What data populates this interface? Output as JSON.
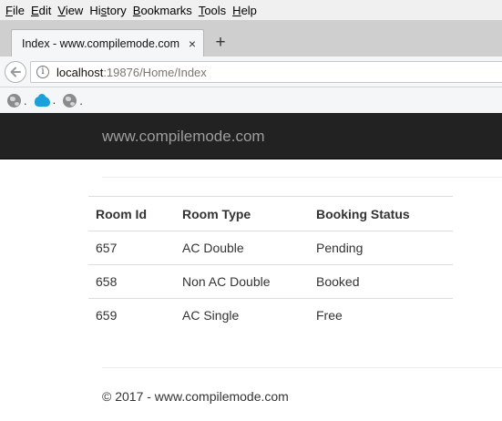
{
  "menu": [
    {
      "accel": "F",
      "rest": "ile"
    },
    {
      "accel": "E",
      "rest": "dit"
    },
    {
      "accel": "V",
      "rest": "iew"
    },
    {
      "pre": "Hi",
      "accel": "s",
      "rest": "tory"
    },
    {
      "accel": "B",
      "rest": "ookmarks"
    },
    {
      "accel": "T",
      "rest": "ools"
    },
    {
      "accel": "H",
      "rest": "elp"
    }
  ],
  "tab": {
    "title": "Index - www.compilemode.com",
    "close": "×",
    "new_tab": "+"
  },
  "address": {
    "host": "localhost",
    "rest": ":19876/Home/Index",
    "info": "i"
  },
  "bookmarks": [
    {
      "icon": "globe-icon",
      "label": "."
    },
    {
      "icon": "salesforce-cloud-icon",
      "label": "."
    },
    {
      "icon": "globe-icon",
      "label": "."
    }
  ],
  "site": {
    "brand": "www.compilemode.com"
  },
  "table": {
    "headers": [
      "Room Id",
      "Room Type",
      "Booking Status"
    ],
    "rows": [
      [
        "657",
        "AC Double",
        "Pending"
      ],
      [
        "658",
        "Non AC Double",
        "Booked"
      ],
      [
        "659",
        "AC Single",
        "Free"
      ]
    ]
  },
  "footer": {
    "text": "© 2017 - www.compilemode.com"
  },
  "colors": {
    "header_bg": "#222222",
    "brand_text": "#9d9d9d",
    "cloud_accent": "#1ba0db"
  }
}
